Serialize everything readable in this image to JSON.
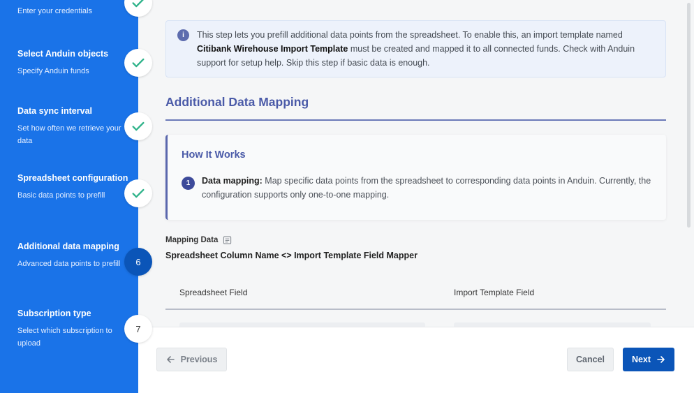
{
  "sidebar": {
    "steps": [
      {
        "title": "",
        "desc": "Enter your credentials",
        "status": "done"
      },
      {
        "title": "Select Anduin objects",
        "desc": "Specify Anduin funds",
        "status": "done"
      },
      {
        "title": "Data sync interval",
        "desc": "Set how often we retrieve your data",
        "status": "done"
      },
      {
        "title": "Spreadsheet configuration",
        "desc": "Basic data points to prefill",
        "status": "done"
      },
      {
        "title": "Additional data mapping",
        "desc": "Advanced data points to prefill",
        "status": "current",
        "number": "6"
      },
      {
        "title": "Subscription type",
        "desc": "Select which subscription to upload",
        "status": "pending",
        "number": "7"
      }
    ]
  },
  "info": {
    "text_before": "This step lets you prefill additional data points from the spreadsheet. To enable this, an import template named ",
    "template_name": "Citibank Wirehouse Import Template",
    "text_after": " must be created and mapped it to all connected funds. Check with Anduin support for setup help. Skip this step if basic data is enough."
  },
  "section": {
    "title": "Additional Data Mapping"
  },
  "how_it_works": {
    "title": "How It Works",
    "item_number": "1",
    "item_label": "Data mapping:",
    "item_text": " Map specific data points from the spreadsheet to corresponding data points in Anduin. Currently, the configuration supports only one-to-one mapping."
  },
  "mapping": {
    "label": "Mapping Data",
    "title": "Spreadsheet Column Name <> Import Template Field Mapper",
    "columns": [
      "Spreadsheet Field",
      "Import Template Field"
    ]
  },
  "footer": {
    "previous": "Previous",
    "cancel": "Cancel",
    "next": "Next"
  },
  "colors": {
    "sidebar": "#1a73e8",
    "primary_button": "#0b55b8",
    "accent": "#4a5aa8",
    "check": "#2fb38a"
  }
}
